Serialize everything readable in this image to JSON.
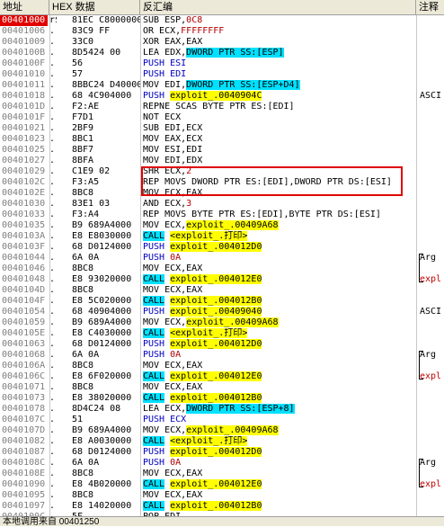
{
  "headers": {
    "addr": "地址",
    "hex": "HEX 数据",
    "asm": "反汇编",
    "cmt": "注释"
  },
  "rows": [
    {
      "addr": "00401000",
      "mark": "r$",
      "hex": "81EC C8000000",
      "sel": true,
      "asm": [
        [
          "SUB ESP,",
          ""
        ],
        [
          "0C8",
          "n"
        ]
      ],
      "cmt": ""
    },
    {
      "addr": "00401006",
      "mark": ".",
      "hex": "83C9 FF",
      "asm": [
        [
          "OR ECX,",
          ""
        ],
        [
          "FFFFFFFF",
          "n"
        ]
      ],
      "cmt": ""
    },
    {
      "addr": "00401009",
      "mark": ".",
      "hex": "33C0",
      "asm": [
        [
          "XOR EAX,EAX",
          ""
        ]
      ],
      "cmt": ""
    },
    {
      "addr": "0040100B",
      "mark": ".",
      "hex": "8D5424 00",
      "asm": [
        [
          "LEA EDX,",
          ""
        ],
        [
          "DWORD PTR SS:[ESP]",
          "c"
        ]
      ],
      "cmt": ""
    },
    {
      "addr": "0040100F",
      "mark": ".",
      "hex": "56",
      "asm": [
        [
          "PUSH ESI",
          "p"
        ]
      ],
      "cmt": ""
    },
    {
      "addr": "00401010",
      "mark": ".",
      "hex": "57",
      "asm": [
        [
          "PUSH EDI",
          "p"
        ]
      ],
      "cmt": ""
    },
    {
      "addr": "00401011",
      "mark": ".",
      "hex": "8BBC24 D4000000",
      "asm": [
        [
          "MOV EDI,",
          ""
        ],
        [
          "DWORD PTR SS:[ESP+D4]",
          "c"
        ]
      ],
      "cmt": ""
    },
    {
      "addr": "00401018",
      "mark": ".",
      "hex": "68 4C904000",
      "asm": [
        [
          "PUSH ",
          "p"
        ],
        [
          "exploit_.0040904C",
          "y"
        ]
      ],
      "cmt": "ASCI"
    },
    {
      "addr": "0040101D",
      "mark": ".",
      "hex": "F2:AE",
      "asm": [
        [
          "REPNE SCAS BYTE PTR ES:[EDI]",
          ""
        ]
      ],
      "cmt": ""
    },
    {
      "addr": "0040101F",
      "mark": ".",
      "hex": "F7D1",
      "asm": [
        [
          "NOT ECX",
          ""
        ]
      ],
      "cmt": ""
    },
    {
      "addr": "00401021",
      "mark": ".",
      "hex": "2BF9",
      "asm": [
        [
          "SUB EDI,ECX",
          ""
        ]
      ],
      "cmt": ""
    },
    {
      "addr": "00401023",
      "mark": ".",
      "hex": "8BC1",
      "asm": [
        [
          "MOV EAX,ECX",
          ""
        ]
      ],
      "cmt": ""
    },
    {
      "addr": "00401025",
      "mark": ".",
      "hex": "8BF7",
      "asm": [
        [
          "MOV ESI,EDI",
          ""
        ]
      ],
      "cmt": ""
    },
    {
      "addr": "00401027",
      "mark": ".",
      "hex": "8BFA",
      "asm": [
        [
          "MOV EDI,EDX",
          ""
        ]
      ],
      "cmt": ""
    },
    {
      "addr": "00401029",
      "mark": ".",
      "hex": "C1E9 02",
      "asm": [
        [
          "SHR ECX,",
          ""
        ],
        [
          "2",
          "n"
        ]
      ],
      "cmt": ""
    },
    {
      "addr": "0040102C",
      "mark": ".",
      "hex": "F3:A5",
      "asm": [
        [
          "REP MOVS DWORD PTR ES:[EDI],DWORD PTR DS:[ESI]",
          ""
        ]
      ],
      "cmt": ""
    },
    {
      "addr": "0040102E",
      "mark": ".",
      "hex": "8BC8",
      "asm": [
        [
          "MOV ECX,EAX",
          ""
        ]
      ],
      "cmt": ""
    },
    {
      "addr": "00401030",
      "mark": ".",
      "hex": "83E1 03",
      "asm": [
        [
          "AND ECX,",
          ""
        ],
        [
          "3",
          "n"
        ]
      ],
      "cmt": ""
    },
    {
      "addr": "00401033",
      "mark": ".",
      "hex": "F3:A4",
      "asm": [
        [
          "REP MOVS BYTE PTR ES:[EDI],BYTE PTR DS:[ESI]",
          ""
        ]
      ],
      "cmt": ""
    },
    {
      "addr": "00401035",
      "mark": ".",
      "hex": "B9 689A4000",
      "asm": [
        [
          "MOV ECX,",
          ""
        ],
        [
          "exploit_.00409A68",
          "y"
        ]
      ],
      "cmt": ""
    },
    {
      "addr": "0040103A",
      "mark": ".",
      "hex": "E8 E8030000",
      "asm": [
        [
          "CALL",
          "c"
        ],
        [
          " ",
          ""
        ],
        [
          "<exploit_.打印>",
          "y"
        ]
      ],
      "cmt": ""
    },
    {
      "addr": "0040103F",
      "mark": ".",
      "hex": "68 D0124000",
      "asm": [
        [
          "PUSH ",
          "p"
        ],
        [
          "exploit_.004012D0",
          "y"
        ]
      ],
      "cmt": ""
    },
    {
      "addr": "00401044",
      "mark": ".",
      "hex": "6A 0A",
      "asm": [
        [
          "PUSH ",
          "p"
        ],
        [
          "0A",
          "n"
        ]
      ],
      "cmt": "Arg"
    },
    {
      "addr": "00401046",
      "mark": ".",
      "hex": "8BC8",
      "asm": [
        [
          "MOV ECX,EAX",
          ""
        ]
      ],
      "cmt": ""
    },
    {
      "addr": "00401048",
      "mark": ".",
      "hex": "E8 93020000",
      "asm": [
        [
          "CALL",
          "c"
        ],
        [
          " ",
          ""
        ],
        [
          "exploit_.004012E0",
          "y"
        ]
      ],
      "cmt": "expl"
    },
    {
      "addr": "0040104D",
      "mark": ".",
      "hex": "8BC8",
      "asm": [
        [
          "MOV ECX,EAX",
          ""
        ]
      ],
      "cmt": ""
    },
    {
      "addr": "0040104F",
      "mark": ".",
      "hex": "E8 5C020000",
      "asm": [
        [
          "CALL",
          "c"
        ],
        [
          " ",
          ""
        ],
        [
          "exploit_.004012B0",
          "y"
        ]
      ],
      "cmt": ""
    },
    {
      "addr": "00401054",
      "mark": ".",
      "hex": "68 40904000",
      "asm": [
        [
          "PUSH ",
          "p"
        ],
        [
          "exploit_.00409040",
          "y"
        ]
      ],
      "cmt": "ASCI"
    },
    {
      "addr": "00401059",
      "mark": ".",
      "hex": "B9 689A4000",
      "asm": [
        [
          "MOV ECX,",
          ""
        ],
        [
          "exploit_.00409A68",
          "y"
        ]
      ],
      "cmt": ""
    },
    {
      "addr": "0040105E",
      "mark": ".",
      "hex": "E8 C4030000",
      "asm": [
        [
          "CALL",
          "c"
        ],
        [
          " ",
          ""
        ],
        [
          "<exploit_.打印>",
          "y"
        ]
      ],
      "cmt": ""
    },
    {
      "addr": "00401063",
      "mark": ".",
      "hex": "68 D0124000",
      "asm": [
        [
          "PUSH ",
          "p"
        ],
        [
          "exploit_.004012D0",
          "y"
        ]
      ],
      "cmt": ""
    },
    {
      "addr": "00401068",
      "mark": ".",
      "hex": "6A 0A",
      "asm": [
        [
          "PUSH ",
          "p"
        ],
        [
          "0A",
          "n"
        ]
      ],
      "cmt": "Arg"
    },
    {
      "addr": "0040106A",
      "mark": ".",
      "hex": "8BC8",
      "asm": [
        [
          "MOV ECX,EAX",
          ""
        ]
      ],
      "cmt": ""
    },
    {
      "addr": "0040106C",
      "mark": ".",
      "hex": "E8 6F020000",
      "asm": [
        [
          "CALL",
          "c"
        ],
        [
          " ",
          ""
        ],
        [
          "exploit_.004012E0",
          "y"
        ]
      ],
      "cmt": "expl"
    },
    {
      "addr": "00401071",
      "mark": ".",
      "hex": "8BC8",
      "asm": [
        [
          "MOV ECX,EAX",
          ""
        ]
      ],
      "cmt": ""
    },
    {
      "addr": "00401073",
      "mark": ".",
      "hex": "E8 38020000",
      "asm": [
        [
          "CALL",
          "c"
        ],
        [
          " ",
          ""
        ],
        [
          "exploit_.004012B0",
          "y"
        ]
      ],
      "cmt": ""
    },
    {
      "addr": "00401078",
      "mark": ".",
      "hex": "8D4C24 08",
      "asm": [
        [
          "LEA ECX,",
          ""
        ],
        [
          "DWORD PTR SS:[ESP+8]",
          "c"
        ]
      ],
      "cmt": ""
    },
    {
      "addr": "0040107C",
      "mark": ".",
      "hex": "51",
      "asm": [
        [
          "PUSH ECX",
          "p"
        ]
      ],
      "cmt": ""
    },
    {
      "addr": "0040107D",
      "mark": ".",
      "hex": "B9 689A4000",
      "asm": [
        [
          "MOV ECX,",
          ""
        ],
        [
          "exploit_.00409A68",
          "y"
        ]
      ],
      "cmt": ""
    },
    {
      "addr": "00401082",
      "mark": ".",
      "hex": "E8 A0030000",
      "asm": [
        [
          "CALL",
          "c"
        ],
        [
          " ",
          ""
        ],
        [
          "<exploit_.打印>",
          "y"
        ]
      ],
      "cmt": ""
    },
    {
      "addr": "00401087",
      "mark": ".",
      "hex": "68 D0124000",
      "asm": [
        [
          "PUSH ",
          "p"
        ],
        [
          "exploit_.004012D0",
          "y"
        ]
      ],
      "cmt": ""
    },
    {
      "addr": "0040108C",
      "mark": ".",
      "hex": "6A 0A",
      "asm": [
        [
          "PUSH ",
          "p"
        ],
        [
          "0A",
          "n"
        ]
      ],
      "cmt": "Arg"
    },
    {
      "addr": "0040108E",
      "mark": ".",
      "hex": "8BC8",
      "asm": [
        [
          "MOV ECX,EAX",
          ""
        ]
      ],
      "cmt": ""
    },
    {
      "addr": "00401090",
      "mark": ".",
      "hex": "E8 4B020000",
      "asm": [
        [
          "CALL",
          "c"
        ],
        [
          " ",
          ""
        ],
        [
          "exploit_.004012E0",
          "y"
        ]
      ],
      "cmt": "expl"
    },
    {
      "addr": "00401095",
      "mark": ".",
      "hex": "8BC8",
      "asm": [
        [
          "MOV ECX,EAX",
          ""
        ]
      ],
      "cmt": ""
    },
    {
      "addr": "00401097",
      "mark": ".",
      "hex": "E8 14020000",
      "asm": [
        [
          "CALL",
          "c"
        ],
        [
          " ",
          ""
        ],
        [
          "exploit_.004012B0",
          "y"
        ]
      ],
      "cmt": ""
    },
    {
      "addr": "0040109C",
      "mark": ".",
      "hex": "5F",
      "asm": [
        [
          "POP EDI",
          ""
        ]
      ],
      "cmt": ""
    }
  ],
  "status": "本地调用来自 00401250",
  "colors": {
    "selection": "#e00000",
    "highlight_yellow": "#ffff00",
    "highlight_cyan": "#00e0ff",
    "push": "#0000c0",
    "number": "#b00000"
  }
}
